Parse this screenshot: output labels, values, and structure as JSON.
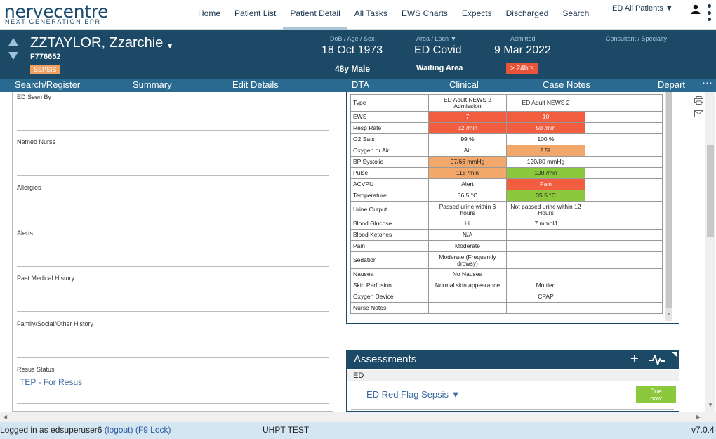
{
  "logo": {
    "main": "nervecentre",
    "sub": "NEXT GENERATION EPR"
  },
  "nav": {
    "items": [
      "Home",
      "Patient List",
      "Patient Detail",
      "All Tasks",
      "EWS Charts",
      "Expects",
      "Discharged",
      "Search"
    ],
    "active": "Patient Detail",
    "patient_filter": "ED All Patients ▼"
  },
  "patient": {
    "name": "ZZTAYLOR, Zzarchie",
    "id": "F776652",
    "alert_badge": "SEPSIS",
    "dob_label": "DoB / Age / Sex",
    "dob": "18 Oct 1973",
    "age_sex": "48y Male",
    "area_label": "Area / Locn ▼",
    "area": "ED Covid",
    "location": "Waiting Area",
    "admitted_label": "Admitted",
    "admitted": "9 Mar 2022",
    "wait_badge": "> 24hrs",
    "consultant_label": "Consultant / Specialty"
  },
  "subnav": {
    "items": [
      "Search/Register",
      "Summary",
      "Edit Details",
      "DTA",
      "Clinical",
      "Case Notes",
      "Depart"
    ],
    "more": "⋯"
  },
  "form": {
    "ed_seen_by": "ED Seen By",
    "named_nurse": "Named Nurse",
    "allergies": "Allergies",
    "alerts": "Alerts",
    "pmh": "Past Medical History",
    "family": "Family/Social/Other History",
    "resus_label": "Resus Status",
    "resus_value": "TEP - For Resus"
  },
  "obs": {
    "colors": {
      "red": "#f25c3f",
      "orange": "#f3a86b",
      "green": "#8cc83c"
    },
    "rows": [
      {
        "label": "Type",
        "v1": "ED Adult NEWS 2 Admission",
        "v2": "ED Adult NEWS 2",
        "v3": "",
        "c1": "",
        "c2": ""
      },
      {
        "label": "EWS",
        "v1": "7",
        "v2": "10",
        "v3": "",
        "c1": "red",
        "c2": "red"
      },
      {
        "label": "Resp Rate",
        "v1": "32 /min",
        "v2": "50 /min",
        "v3": "",
        "c1": "red",
        "c2": "red"
      },
      {
        "label": "O2 Sats",
        "v1": "99 %",
        "v2": "100 %",
        "v3": "",
        "c1": "",
        "c2": ""
      },
      {
        "label": "Oxygen or Air",
        "v1": "Air",
        "v2": "2.5L",
        "v3": "",
        "c1": "",
        "c2": "orange"
      },
      {
        "label": "BP Systolic",
        "v1": "97/66 mmHg",
        "v2": "120/80 mmHg",
        "v3": "",
        "c1": "orange",
        "c2": ""
      },
      {
        "label": "Pulse",
        "v1": "118 /min",
        "v2": "100 /min",
        "v3": "",
        "c1": "orange",
        "c2": "green"
      },
      {
        "label": "ACVPU",
        "v1": "Alert",
        "v2": "Pain",
        "v3": "",
        "c1": "",
        "c2": "red"
      },
      {
        "label": "Temperature",
        "v1": "36.5 °C",
        "v2": "35.5 °C",
        "v3": "",
        "c1": "",
        "c2": "green"
      },
      {
        "label": "Urine Output",
        "v1": "Passed urine within 6 hours",
        "v2": "Not passed urine within 12 Hours",
        "v3": "",
        "c1": "",
        "c2": ""
      },
      {
        "label": "Blood Glucose",
        "v1": "Hi",
        "v2": "7 mmol/l",
        "v3": "",
        "c1": "",
        "c2": ""
      },
      {
        "label": "Blood Ketones",
        "v1": "N/A",
        "v2": "",
        "v3": "",
        "c1": "",
        "c2": ""
      },
      {
        "label": "Pain",
        "v1": "Moderate",
        "v2": "",
        "v3": "",
        "c1": "",
        "c2": ""
      },
      {
        "label": "Sedation",
        "v1": "Moderate (Frequently drowsy)",
        "v2": "",
        "v3": "",
        "c1": "",
        "c2": ""
      },
      {
        "label": "Nausea",
        "v1": "No Nausea",
        "v2": "",
        "v3": "",
        "c1": "",
        "c2": ""
      },
      {
        "label": "Skin Perfusion",
        "v1": "Normal skin appearance",
        "v2": "Mottled",
        "v3": "",
        "c1": "",
        "c2": ""
      },
      {
        "label": "Oxygen Device",
        "v1": "",
        "v2": "CPAP",
        "v3": "",
        "c1": "",
        "c2": ""
      },
      {
        "label": "Nurse Notes",
        "v1": "",
        "v2": "",
        "v3": "",
        "c1": "",
        "c2": ""
      }
    ]
  },
  "assessments": {
    "title": "Assessments",
    "plus": "+",
    "group": "ED",
    "item": "ED Red Flag Sepsis ▼",
    "due": "Due now"
  },
  "footer": {
    "logged_in": "Logged in as edsuperuser6",
    "logout": "(logout)",
    "lock": "(F9 Lock)",
    "env": "UHPT TEST",
    "version": "v7.0.4"
  }
}
